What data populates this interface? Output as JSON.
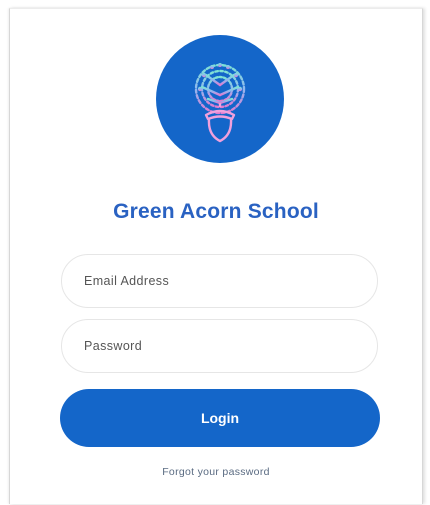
{
  "school": {
    "name": "Green Acorn School",
    "logo_icon": "tree-acorn-icon",
    "brand_color": "#1466c9",
    "title_color": "#2a62c2"
  },
  "form": {
    "email_placeholder": "Email Address",
    "email_value": "",
    "password_placeholder": "Password",
    "password_value": "",
    "login_label": "Login",
    "forgot_label": "Forgot your password"
  }
}
